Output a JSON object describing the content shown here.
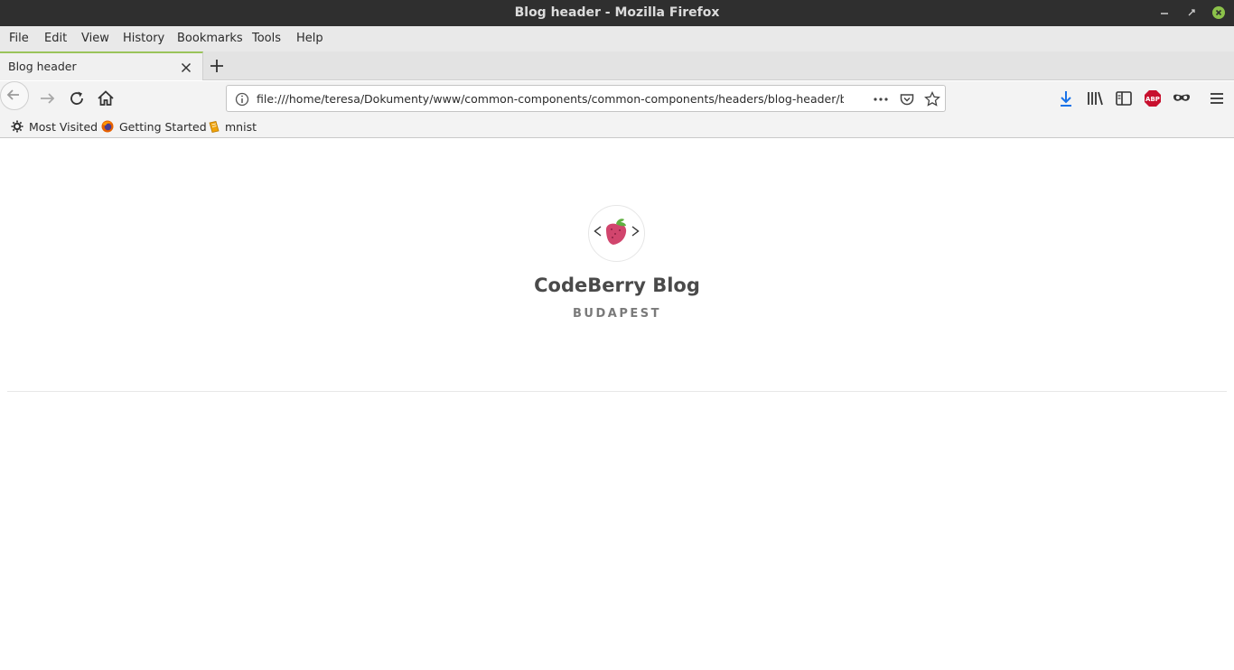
{
  "window": {
    "title": "Blog header - Mozilla Firefox"
  },
  "menu": {
    "file": "File",
    "edit": "Edit",
    "view": "View",
    "history": "History",
    "bookmarks": "Bookmarks",
    "tools": "Tools",
    "help": "Help"
  },
  "tab": {
    "title": "Blog header"
  },
  "urlbar": {
    "url": "file:///home/teresa/Dokumenty/www/common-components/common-components/headers/blog-header/blog-header"
  },
  "bookmarks_bar": {
    "most_visited": "Most Visited",
    "getting_started": "Getting Started",
    "mnist": "mnist"
  },
  "header": {
    "title": "CodeBerry Blog",
    "subtitle": "BUDAPEST"
  },
  "colors": {
    "accent_download": "#1a73e8",
    "abp_red": "#c8102e",
    "berry": "#d1456d",
    "leaf": "#5fb041",
    "tab_accent": "#9ac45a"
  }
}
